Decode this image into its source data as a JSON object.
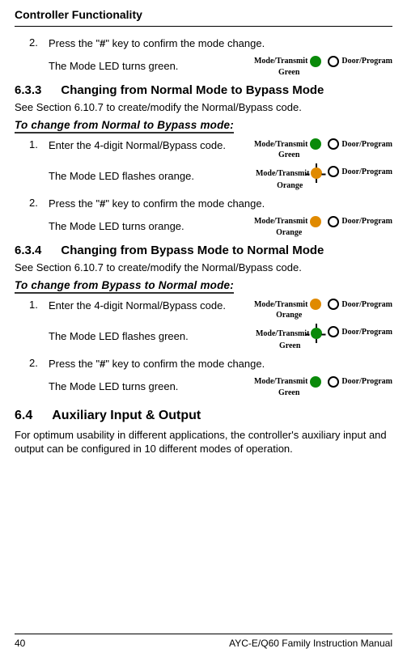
{
  "header": "Controller Functionality",
  "step2": {
    "num": "2.",
    "text_a": "Press the \"",
    "hash": "#",
    "text_b": "\" key to confirm the mode change."
  },
  "led_turns_green": "The Mode LED turns green.",
  "led_flashes_orange": "The Mode LED flashes orange.",
  "led_turns_orange": "The Mode LED turns orange.",
  "led_flashes_green": "The Mode LED flashes green.",
  "diagram": {
    "mode_transmit": "Mode/Transmit",
    "door_program": "Door/Program",
    "green": "Green",
    "orange": "Orange"
  },
  "sec633": {
    "num": "6.3.3",
    "title": "Changing from Normal Mode to Bypass Mode"
  },
  "see_ref": "See Section 6.10.7 to create/modify the Normal/Bypass code.",
  "proc_n2b": "To change from Normal to Bypass mode:",
  "step1": {
    "num": "1.",
    "text": "Enter the 4-digit Normal/Bypass code."
  },
  "sec634": {
    "num": "6.3.4",
    "title": "Changing from Bypass Mode to Normal Mode"
  },
  "proc_b2n": "To change from Bypass to Normal mode:",
  "sec64": {
    "num": "6.4",
    "title": "Auxiliary Input & Output"
  },
  "aux_para": "For optimum usability in different applications, the controller's auxiliary input and output can be configured in 10 different modes of operation.",
  "footer": {
    "page": "40",
    "manual": "AYC-E/Q60 Family Instruction Manual"
  }
}
